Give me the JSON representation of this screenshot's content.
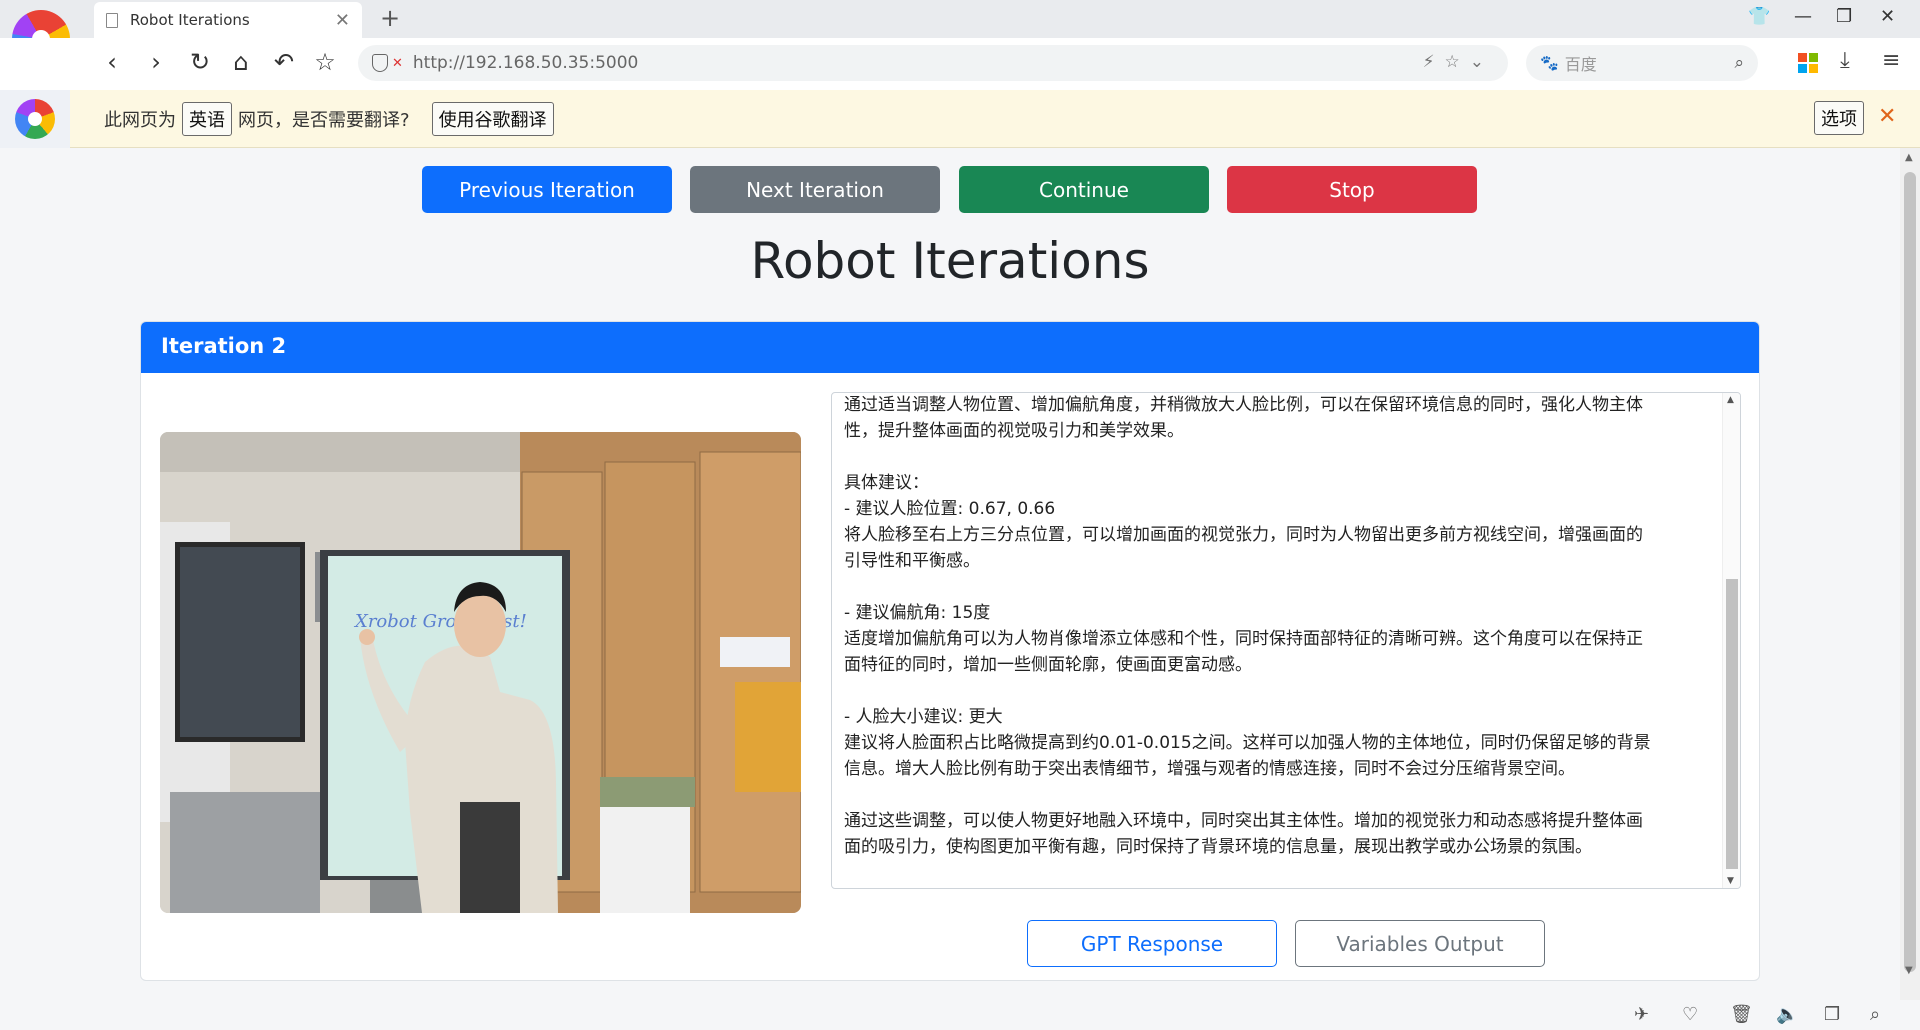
{
  "browser": {
    "tab_title": "Robot Iterations",
    "tab_close": "✕",
    "new_tab": "+",
    "url": "http://192.168.50.35:5000",
    "search_placeholder": "百度",
    "window_controls": [
      "minimize-icon",
      "restore-icon",
      "close-icon"
    ]
  },
  "translate_bar": {
    "prefix": "此网页为",
    "language": "英语",
    "question": "网页，是否需要翻译?",
    "translate_button": "使用谷歌翻译",
    "options_button": "选项",
    "close": "✕"
  },
  "controls": {
    "previous": "Previous Iteration",
    "next": "Next Iteration",
    "continue": "Continue",
    "stop": "Stop"
  },
  "page_title": "Robot Iterations",
  "iteration": {
    "header": "Iteration 2",
    "photo_board_text": "Xrobot Group test!",
    "response_text": "通过适当调整人物位置、增加偏航角度，并稍微放大人脸比例，可以在保留环境信息的同时，强化人物主体\n性，提升整体画面的视觉吸引力和美学效果。\n\n具体建议：\n- 建议人脸位置: 0.67, 0.66\n将人脸移至右上方三分点位置，可以增加画面的视觉张力，同时为人物留出更多前方视线空间，增强画面的\n引导性和平衡感。\n\n- 建议偏航角: 15度\n适度增加偏航角可以为人物肖像增添立体感和个性，同时保持面部特征的清晰可辨。这个角度可以在保持正\n面特征的同时，增加一些侧面轮廓，使画面更富动感。\n\n- 人脸大小建议: 更大\n建议将人脸面积占比略微提高到约0.01-0.015之间。这样可以加强人物的主体地位，同时仍保留足够的背景\n信息。增大人脸比例有助于突出表情细节，增强与观者的情感连接，同时不会过分压缩背景空间。\n\n通过这些调整，可以使人物更好地融入环境中，同时突出其主体性。增加的视觉张力和动态感将提升整体画\n面的吸引力，使构图更加平衡有趣，同时保持了背景环境的信息量，展现出教学或办公场景的氛围。",
    "gpt_button": "GPT Response",
    "vars_button": "Variables Output"
  },
  "colors": {
    "primary": "#0d6efd",
    "secondary": "#6c757d",
    "success": "#198754",
    "danger": "#dc3545"
  }
}
